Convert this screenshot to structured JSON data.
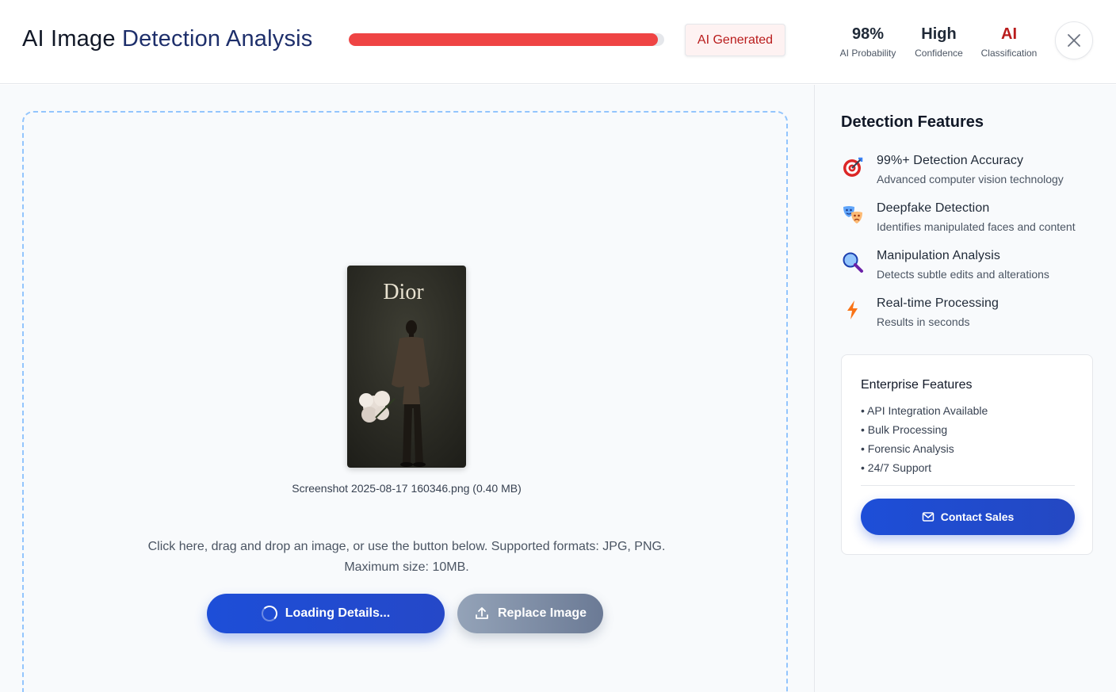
{
  "header": {
    "title_part1": "AI Image",
    "title_part2": "Detection Analysis",
    "progress_fraction": 0.98,
    "progress_color": "#ef4444",
    "badge_label": "AI Generated",
    "stats": [
      {
        "value": "98%",
        "label": "AI Probability",
        "color": "#1f2937"
      },
      {
        "value": "High",
        "label": "Confidence",
        "color": "#1f2937"
      },
      {
        "value": "AI",
        "label": "Classification",
        "color": "#b91c1c"
      }
    ],
    "close_icon": "close-icon"
  },
  "upload": {
    "preview_brand": "Dior",
    "file_name": "Screenshot 2025-08-17 160346.png (0.40 MB)",
    "instructions_line1": "Click here, drag and drop an image, or use the button below. Supported formats: JPG, PNG.",
    "instructions_line2": "Maximum size: 10MB.",
    "loading_label": "Loading Details...",
    "replace_label": "Replace Image"
  },
  "sidebar": {
    "title": "Detection Features",
    "features": [
      {
        "title": "99%+ Detection Accuracy",
        "desc": "Advanced computer vision technology",
        "icon": "target-icon"
      },
      {
        "title": "Deepfake Detection",
        "desc": "Identifies manipulated faces and content",
        "icon": "masks-icon"
      },
      {
        "title": "Manipulation Analysis",
        "desc": "Detects subtle edits and alterations",
        "icon": "magnifier-icon"
      },
      {
        "title": "Real-time Processing",
        "desc": "Results in seconds",
        "icon": "lightning-icon"
      }
    ],
    "enterprise": {
      "title": "Enterprise Features",
      "items": [
        "• API Integration Available",
        "• Bulk Processing",
        "• Forensic Analysis",
        "• 24/7 Support"
      ],
      "contact_label": "Contact Sales"
    }
  }
}
